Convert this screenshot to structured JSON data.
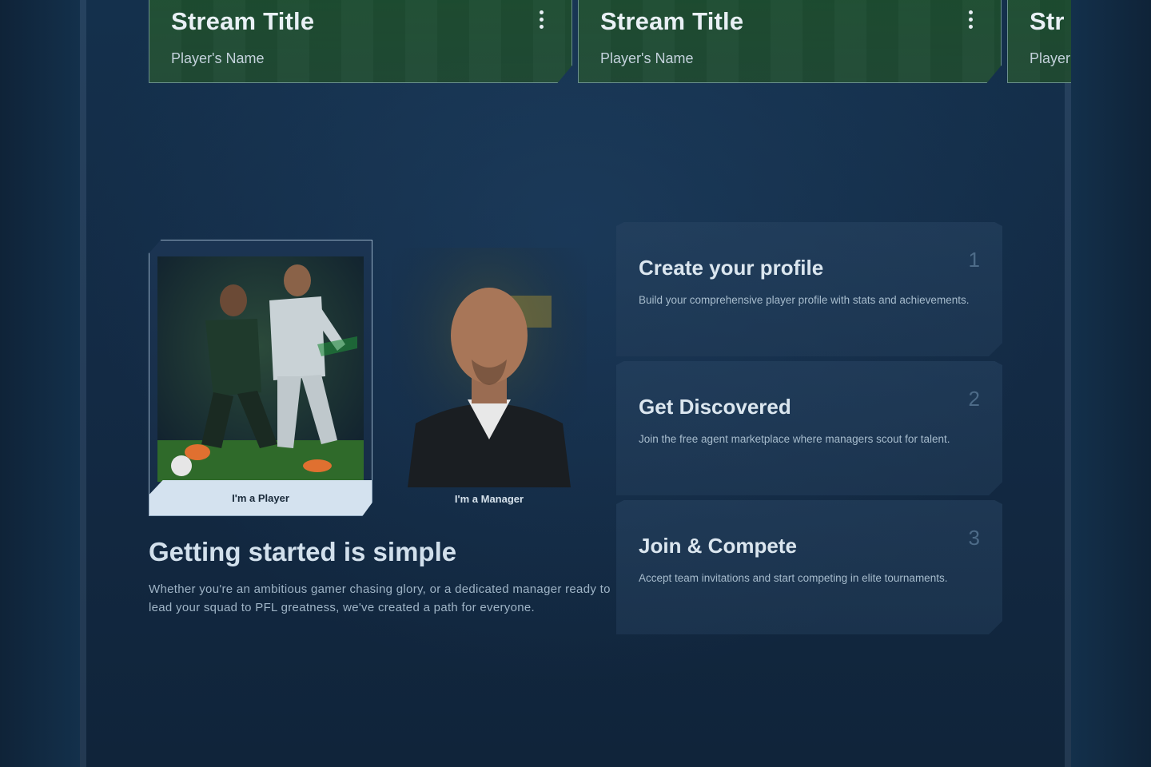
{
  "streams": [
    {
      "title": "Stream Title",
      "player": "Player's Name"
    },
    {
      "title": "Stream Title",
      "player": "Player's Name"
    },
    {
      "title": "Str",
      "player": "Player"
    }
  ],
  "roles": {
    "player_label": "I'm a Player",
    "manager_label": "I'm a Manager"
  },
  "section": {
    "title": "Getting started is simple",
    "description": "Whether you're an ambitious gamer chasing glory, or a dedicated manager ready to lead your squad to PFL greatness, we've created a path for everyone."
  },
  "steps": [
    {
      "number": "1",
      "title": "Create your profile",
      "description": "Build your comprehensive player profile with stats and achievements."
    },
    {
      "number": "2",
      "title": "Get Discovered",
      "description": "Join the free agent marketplace where managers scout for talent."
    },
    {
      "number": "3",
      "title": "Join & Compete",
      "description": "Accept team invitations and start competing in elite tournaments."
    }
  ],
  "colors": {
    "background": "#13304b",
    "accent_card": "#d4e2ef",
    "stream_card": "#224e30"
  }
}
